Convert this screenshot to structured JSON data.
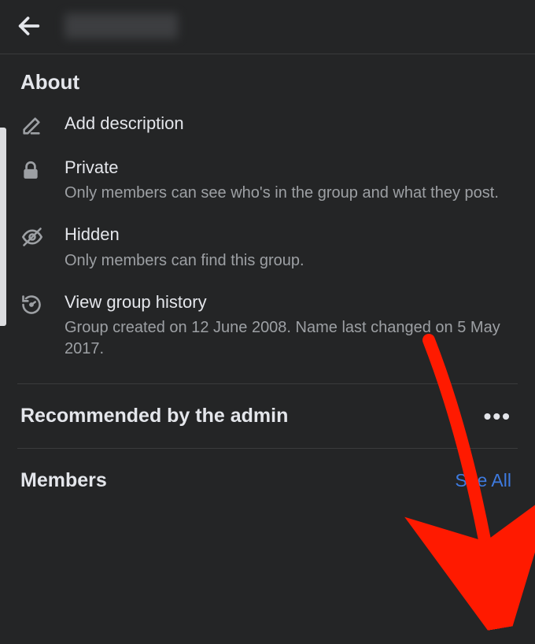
{
  "header": {
    "title": "[Redacted]"
  },
  "about": {
    "heading": "About",
    "items": [
      {
        "label": "Add description",
        "desc": ""
      },
      {
        "label": "Private",
        "desc": "Only members can see who's in the group and what they post."
      },
      {
        "label": "Hidden",
        "desc": "Only members can find this group."
      },
      {
        "label": "View group history",
        "desc": "Group created on 12 June 2008. Name last changed on 5 May 2017."
      }
    ]
  },
  "recommended": {
    "heading": "Recommended by the admin"
  },
  "members": {
    "heading": "Members",
    "see_all": "See All"
  }
}
